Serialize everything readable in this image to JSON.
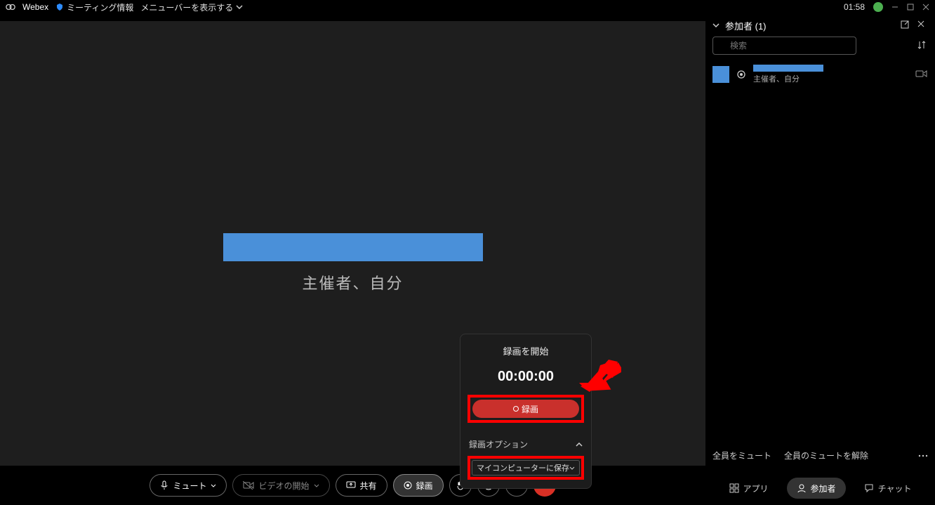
{
  "titlebar": {
    "app_name": "Webex",
    "meeting_info": "ミーティング情報",
    "menubar_toggle": "メニューバーを表示する",
    "time": "01:58"
  },
  "stage": {
    "self_label": "主催者、自分"
  },
  "record_popup": {
    "title": "録画を開始",
    "timer": "00:00:00",
    "record_btn": "録画",
    "options_title": "録画オプション",
    "save_location": "マイコンピューターに保存"
  },
  "toolbar": {
    "mute": "ミュート",
    "video": "ビデオの開始",
    "share": "共有",
    "record": "録画"
  },
  "participants": {
    "title": "参加者 (1)",
    "search_placeholder": "検索",
    "role": "主催者、自分",
    "mute_all": "全員をミュート",
    "unmute_all": "全員のミュートを解除"
  },
  "side_tabs": {
    "apps": "アプリ",
    "participants": "参加者",
    "chat": "チャット"
  }
}
